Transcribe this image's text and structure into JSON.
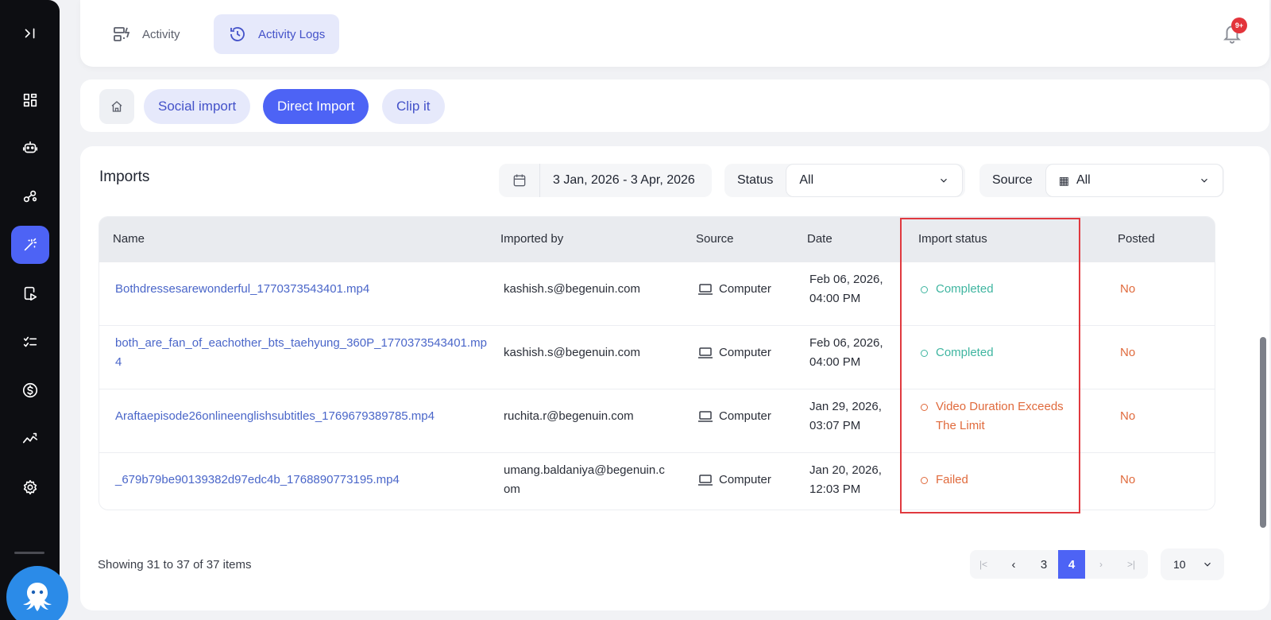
{
  "sidebar": {
    "items": [
      {
        "icon": "expand-icon"
      },
      {
        "icon": "dashboard-icon"
      },
      {
        "icon": "robot-icon"
      },
      {
        "icon": "share-nodes-icon"
      },
      {
        "icon": "magic-wand-icon",
        "active": true
      },
      {
        "icon": "video-play-icon"
      },
      {
        "icon": "checklist-icon"
      },
      {
        "icon": "dollar-icon"
      },
      {
        "icon": "analytics-icon"
      },
      {
        "icon": "settings-icon"
      }
    ]
  },
  "header": {
    "tabs": [
      {
        "label": "Activity",
        "icon": "activity-icon"
      },
      {
        "label": "Activity Logs",
        "icon": "history-icon",
        "active": true
      }
    ],
    "notification_badge": "9+"
  },
  "subtabs": {
    "items": [
      {
        "label": "Social import"
      },
      {
        "label": "Direct Import",
        "active": true
      },
      {
        "label": "Clip it"
      }
    ]
  },
  "main": {
    "title": "Imports",
    "date_range": "3 Jan, 2026 - 3 Apr, 2026",
    "status_filter": {
      "label": "Status",
      "value": "All"
    },
    "source_filter": {
      "label": "Source",
      "value": "All"
    },
    "columns": [
      "Name",
      "Imported by",
      "Source",
      "Date",
      "Import status",
      "Posted"
    ],
    "rows": [
      {
        "name": "Bothdressesarewonderful_1770373543401.mp4",
        "by": "kashish.s@begenuin.com",
        "source": "Computer",
        "date": "Feb 06, 2026, 04:00 PM",
        "status": "Completed",
        "status_type": "success",
        "posted": "No"
      },
      {
        "name": "both_are_fan_of_eachother_bts_taehyung_360P_1770373543401.mp4",
        "by": "kashish.s@begenuin.com",
        "source": "Computer",
        "date": "Feb 06, 2026, 04:00 PM",
        "status": "Completed",
        "status_type": "success",
        "posted": "No"
      },
      {
        "name": "Araftaepisode26onlineenglishsubtitles_1769679389785.mp4",
        "by": "ruchita.r@begenuin.com",
        "source": "Computer",
        "date": "Jan 29, 2026, 03:07 PM",
        "status": "Video Duration Exceeds The Limit",
        "status_type": "error",
        "posted": "No"
      },
      {
        "name": "_679b79be90139382d97edc4b_1768890773195.mp4",
        "by": "umang.baldaniya@begenuin.com",
        "source": "Computer",
        "date": "Jan 20, 2026, 12:03 PM",
        "status": "Failed",
        "status_type": "error",
        "posted": "No"
      }
    ],
    "showing_text": "Showing 31 to 37 of 37 items",
    "pagination": {
      "pages": [
        "3",
        "4"
      ],
      "current": "4"
    },
    "per_page": "10"
  },
  "colors": {
    "accent": "#4d63f5",
    "success": "#3fb5a0",
    "error": "#e06a3c",
    "highlight": "#e0393f"
  }
}
